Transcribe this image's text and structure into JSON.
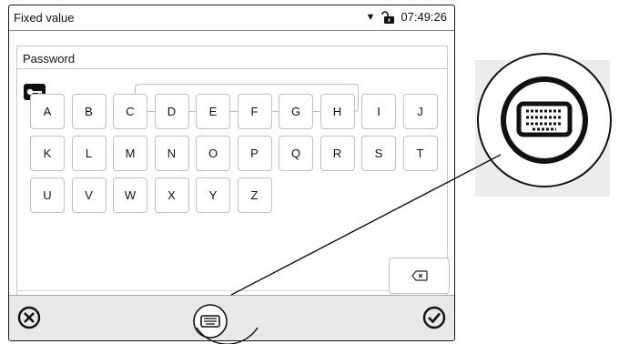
{
  "window": {
    "title": "Fixed value",
    "time": "07:49:26",
    "dropdown_icon": "caret-down-icon",
    "lock_icon": "unlocked-padlock-icon"
  },
  "password": {
    "label": "Password",
    "key_icon": "key-icon",
    "value": ""
  },
  "keyboard": {
    "rows": [
      [
        "A",
        "B",
        "C",
        "D",
        "E",
        "F",
        "G",
        "H",
        "I",
        "J"
      ],
      [
        "K",
        "L",
        "M",
        "N",
        "O",
        "P",
        "Q",
        "R",
        "S",
        "T"
      ],
      [
        "U",
        "V",
        "W",
        "X",
        "Y",
        "Z"
      ]
    ],
    "backspace_icon": "backspace-icon"
  },
  "footer": {
    "cancel_icon": "cancel-icon",
    "keyboard_icon": "keyboard-icon",
    "confirm_icon": "checkmark-icon"
  },
  "callout": {
    "magnified_icon": "keyboard-icon"
  }
}
